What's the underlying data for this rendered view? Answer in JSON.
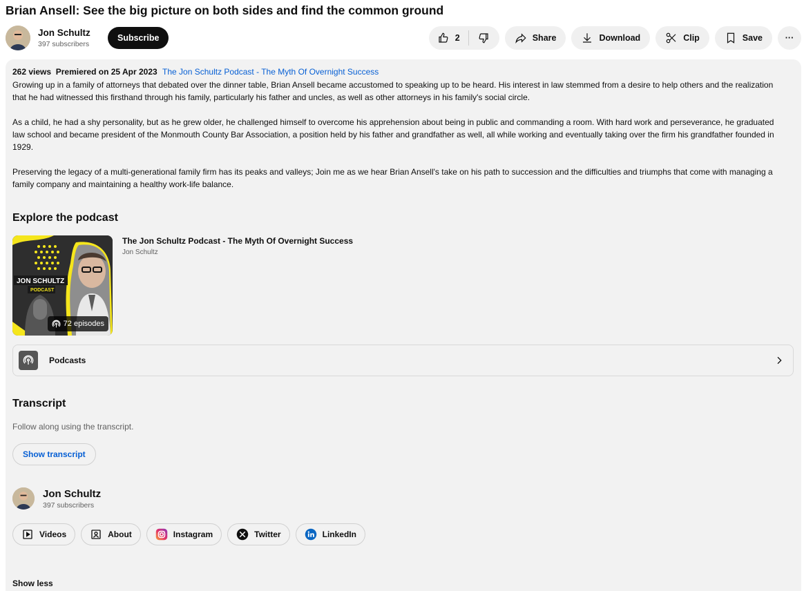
{
  "video": {
    "title": "Brian Ansell: See the big picture on both sides and find the common ground"
  },
  "channel": {
    "name": "Jon Schultz",
    "subscribers": "397 subscribers",
    "subscribe_label": "Subscribe"
  },
  "actions": {
    "like_count": "2",
    "share_label": "Share",
    "download_label": "Download",
    "clip_label": "Clip",
    "save_label": "Save",
    "more_label": "···"
  },
  "description": {
    "views": "262 views",
    "premiered": "Premiered on 25 Apr 2023",
    "playlist_link": "The Jon Schultz Podcast - The Myth Of Overnight Success",
    "paragraphs": [
      "Growing up in a family of attorneys that debated over the dinner table, Brian Ansell became accustomed to speaking up to be heard. His interest in law stemmed from a desire to help others and the realization that he had witnessed this firsthand through his family, particularly his father and uncles, as well as other attorneys in his family's social circle.",
      "As a child, he had a shy personality, but as he grew older, he challenged himself to overcome his apprehension about being in public and commanding a room. With hard work and perseverance, he graduated law school and became president of the Monmouth County Bar Association, a position held by his father and grandfather as well, all while working and eventually taking over the firm his grandfather founded in 1929.",
      "Preserving the legacy of a multi-generational family firm has its peaks and valleys; Join me as we hear Brian Ansell's take on his path to succession and the difficulties and triumphs that come with managing a family company and maintaining a healthy work-life balance."
    ]
  },
  "podcast": {
    "section_title": "Explore the podcast",
    "card_title": "The Jon Schultz Podcast - The Myth Of Overnight Success",
    "card_author": "Jon Schultz",
    "thumbnail_text_line1": "JON SCHULTZ",
    "thumbnail_text_line2": "PODCAST",
    "episodes": "72 episodes",
    "podcasts_label": "Podcasts"
  },
  "transcript": {
    "section_title": "Transcript",
    "note": "Follow along using the transcript.",
    "button_label": "Show transcript"
  },
  "channel_footer": {
    "name": "Jon Schultz",
    "subscribers": "397 subscribers",
    "links": [
      {
        "label": "Videos",
        "icon": "play-box-icon"
      },
      {
        "label": "About",
        "icon": "person-box-icon"
      },
      {
        "label": "Instagram",
        "icon": "instagram-icon"
      },
      {
        "label": "Twitter",
        "icon": "x-twitter-icon"
      },
      {
        "label": "LinkedIn",
        "icon": "linkedin-icon"
      }
    ]
  },
  "show_less_label": "Show less",
  "colors": {
    "link_blue": "#065fd4",
    "accent_yellow": "#f5e61c",
    "panel_bg": "#f2f2f2"
  }
}
